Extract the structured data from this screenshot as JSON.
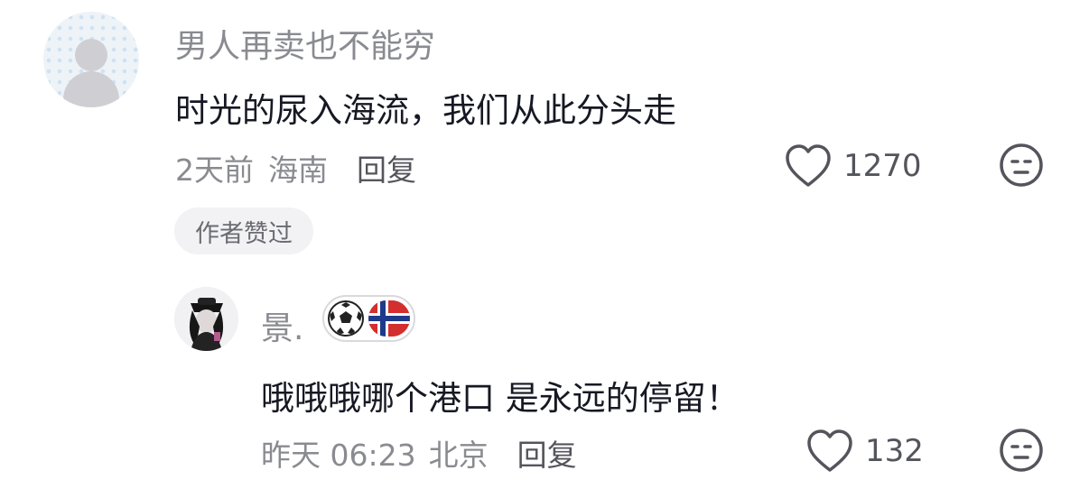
{
  "comments": [
    {
      "username": "男人再卖也不能穷",
      "content": "时光的尿入海流，我们从此分头走",
      "time": "2天前",
      "location": "海南",
      "reply_label": "回复",
      "likes": "1270",
      "author_badge": "作者赞过"
    }
  ],
  "reply": {
    "username": "景.",
    "content": "哦哦哦哪个港口 是永远的停留！",
    "time": "昨天 06:23",
    "location": "北京",
    "reply_label": "回复",
    "likes": "132"
  }
}
